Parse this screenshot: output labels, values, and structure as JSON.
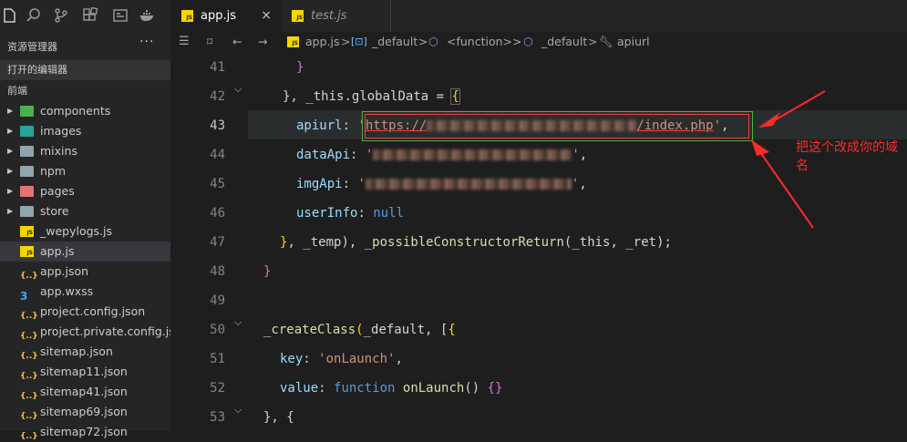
{
  "activity_bar": {
    "icons": [
      "files-icon",
      "search-icon",
      "source-control-icon",
      "extensions-icon",
      "remote-icon",
      "docker-icon"
    ]
  },
  "explorer": {
    "title": "资源管理器",
    "more": "···",
    "sections": {
      "open_editors": "打开的编辑器",
      "project": "前端"
    },
    "tree": [
      {
        "label": "components",
        "type": "folder",
        "icon": "folder-green-icon"
      },
      {
        "label": "images",
        "type": "folder",
        "icon": "folder-images-icon"
      },
      {
        "label": "mixins",
        "type": "folder",
        "icon": "folder-icon"
      },
      {
        "label": "npm",
        "type": "folder",
        "icon": "folder-icon"
      },
      {
        "label": "pages",
        "type": "folder",
        "icon": "folder-pages-icon"
      },
      {
        "label": "store",
        "type": "folder",
        "icon": "folder-icon"
      },
      {
        "label": "_wepylogs.js",
        "type": "js"
      },
      {
        "label": "app.js",
        "type": "js",
        "selected": true
      },
      {
        "label": "app.json",
        "type": "json"
      },
      {
        "label": "app.wxss",
        "type": "css"
      },
      {
        "label": "project.config.json",
        "type": "json"
      },
      {
        "label": "project.private.config.js...",
        "type": "json"
      },
      {
        "label": "sitemap.json",
        "type": "json"
      },
      {
        "label": "sitemap11.json",
        "type": "json"
      },
      {
        "label": "sitemap41.json",
        "type": "json"
      },
      {
        "label": "sitemap69.json",
        "type": "json"
      },
      {
        "label": "sitemap72.json",
        "type": "json"
      }
    ]
  },
  "tabs": [
    {
      "label": "app.js",
      "badge": "JS",
      "active": true,
      "close": "×"
    },
    {
      "label": "test.js",
      "badge": "JS",
      "active": false
    }
  ],
  "breadcrumb": {
    "items": [
      "app.js",
      "_default",
      "<function>",
      "_default",
      "apiurl"
    ],
    "icons": [
      "js-file-icon",
      "variable-icon",
      "cube-icon",
      "cube-icon",
      "wrench-icon"
    ],
    "separator": ">"
  },
  "editor": {
    "line_numbers": [
      "41",
      "42",
      "43",
      "44",
      "45",
      "46",
      "47",
      "48",
      "49",
      "50",
      "51",
      "52",
      "53"
    ],
    "current_line": "43",
    "code": {
      "l41": "}",
      "l42a": "}, ",
      "l42b": "_this",
      "l42c": ".",
      "l42d": "globalData",
      "l42e": " = ",
      "l42f": "{",
      "l43a": "apiurl",
      "l43b": ": ",
      "l43c": "'",
      "l43d": "https://",
      "l43e": "/index.php",
      "l43f": "'",
      "l43g": ",",
      "l44a": "dataApi",
      "l44b": ": ",
      "l44c": "'",
      "l44d": "'",
      "l44e": ",",
      "l45a": "imgApi",
      "l45b": ": ",
      "l45c": "'",
      "l45d": "'",
      "l45e": ",",
      "l46a": "userInfo",
      "l46b": ": ",
      "l46c": "null",
      "l47a": "}",
      "l47b": ", ",
      "l47c": "_temp",
      "l47d": "), ",
      "l47e": "_possibleConstructorReturn",
      "l47f": "(",
      "l47g": "_this",
      "l47h": ", ",
      "l47i": "_ret",
      "l47j": ");",
      "l48": "}",
      "l50a": "_createClass",
      "l50b": "(",
      "l50c": "_default",
      "l50d": ", [",
      "l50e": "{",
      "l51a": "key",
      "l51b": ": ",
      "l51c": "'onLaunch'",
      "l51d": ",",
      "l52a": "value",
      "l52b": ": ",
      "l52c": "function",
      "l52d": " ",
      "l52e": "onLaunch",
      "l52f": "() ",
      "l52g": "{}",
      "l53a": "}, {"
    }
  },
  "annotation": {
    "text": "把这个改成你的域名",
    "color": "#ff2a2a"
  },
  "colors": {
    "keyword": "#569cd6",
    "property": "#9cdcfe",
    "string": "#ce9178",
    "function": "#dcdcaa",
    "bracket": "#ffd700",
    "annotation": "#ff2a2a"
  }
}
